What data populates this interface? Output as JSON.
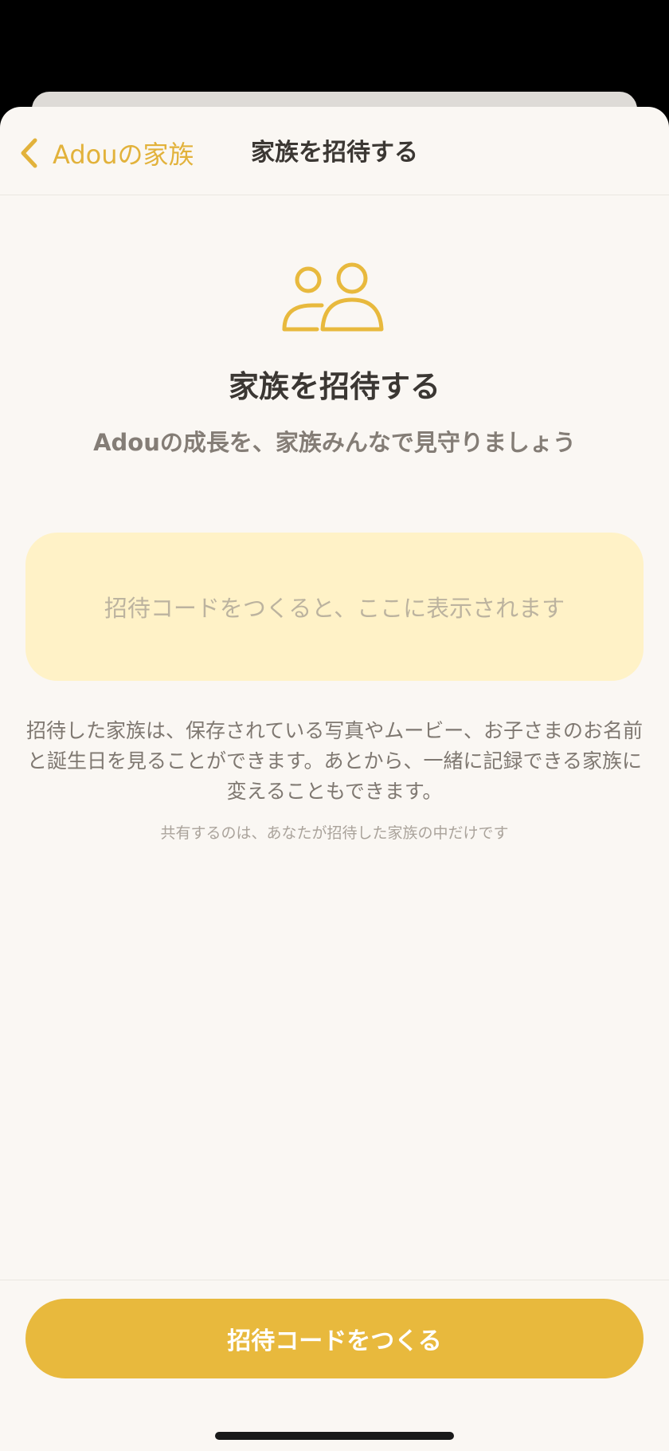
{
  "colors": {
    "accent": "#e8b93d",
    "back_link": "#e2b23b",
    "code_box_background": "#fff2c7",
    "sheet_background": "#faf7f3",
    "title_text": "#3b3733",
    "body_text": "#7f7871"
  },
  "nav": {
    "back_label": "Adouの家族",
    "back_icon": "chevron-left-icon",
    "title": "家族を招待する"
  },
  "hero": {
    "icon": "people-icon",
    "heading": "家族を招待する",
    "subheading": "Adouの成長を、家族みんなで見守りましょう"
  },
  "code_box": {
    "placeholder": "招待コードをつくると、ここに表示されます"
  },
  "description": "招待した家族は、保存されている写真やムービー、お子さまのお名前と誕生日を見ることができます。あとから、一緒に記録できる家族に変えることもできます。",
  "note": "共有するのは、あなたが招待した家族の中だけです",
  "footer": {
    "create_button_label": "招待コードをつくる"
  }
}
